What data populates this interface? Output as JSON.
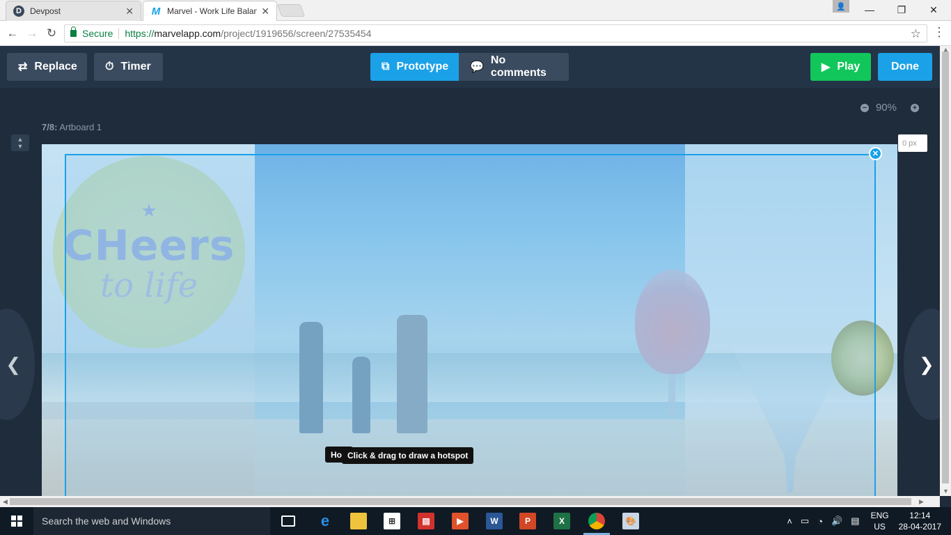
{
  "browser": {
    "tabs": [
      {
        "label": "Devpost",
        "favicon": "D",
        "active": false
      },
      {
        "label": "Marvel - Work Life Balan",
        "favicon": "M",
        "active": true
      }
    ],
    "address": {
      "secure_label": "Secure",
      "url_scheme": "https://",
      "url_host": "marvelapp.com",
      "url_path": "/project/1919656/screen/27535454"
    }
  },
  "toolbar": {
    "replace_label": "Replace",
    "timer_label": "Timer",
    "prototype_label": "Prototype",
    "comments_label": "No comments",
    "play_label": "Play",
    "done_label": "Done"
  },
  "canvas": {
    "zoom_level": "90%",
    "breadcrumb_index": "7/8:",
    "breadcrumb_name": "Artboard 1",
    "px_input_placeholder": "0 px",
    "tooltip_behind": "Ho",
    "tooltip": "Click & drag to draw a hotspot",
    "logo_text_1": "CHeers",
    "logo_text_2": "to life"
  },
  "taskbar": {
    "search_placeholder": "Search the web and Windows",
    "language_1": "ENG",
    "language_2": "US",
    "time": "12:14",
    "date": "28-04-2017"
  },
  "colors": {
    "accent": "#1aa1e8",
    "play_green": "#11c65a",
    "toolbar_bg": "#243447",
    "canvas_bg": "#1f2c3b"
  }
}
